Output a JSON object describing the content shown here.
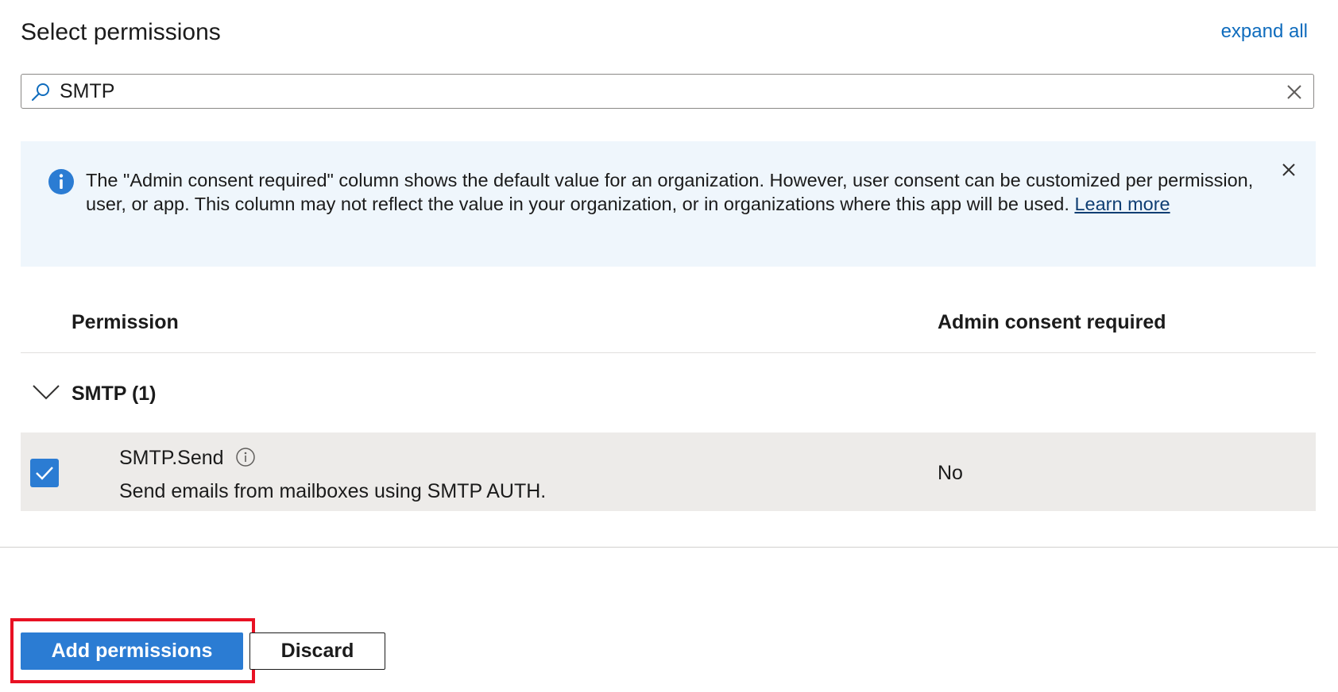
{
  "header": {
    "title": "Select permissions",
    "expand_all": "expand all"
  },
  "search": {
    "value": "SMTP",
    "icon": "search-icon",
    "clear_icon": "close-icon"
  },
  "info_banner": {
    "icon": "info-icon",
    "message": "The \"Admin consent required\" column shows the default value for an organization. However, user consent can be customized per permission, user, or app. This column may not reflect the value in your organization, or in organizations where this app will be used.",
    "link": "Learn more",
    "close_icon": "close-icon"
  },
  "table": {
    "columns": [
      "Permission",
      "Admin consent required"
    ],
    "groups": [
      {
        "label": "SMTP (1)",
        "expanded": true,
        "permissions": [
          {
            "name": "SMTP.Send",
            "description": "Send emails from mailboxes using SMTP AUTH.",
            "admin_consent": "No",
            "checked": true
          }
        ]
      }
    ]
  },
  "footer": {
    "primary_button": "Add permissions",
    "secondary_button": "Discard"
  },
  "colors": {
    "accent": "#2b7cd3",
    "link": "#0f6cbd",
    "banner_bg": "#eff6fc",
    "selected_row_bg": "#edebe9",
    "highlight": "#e81123"
  }
}
